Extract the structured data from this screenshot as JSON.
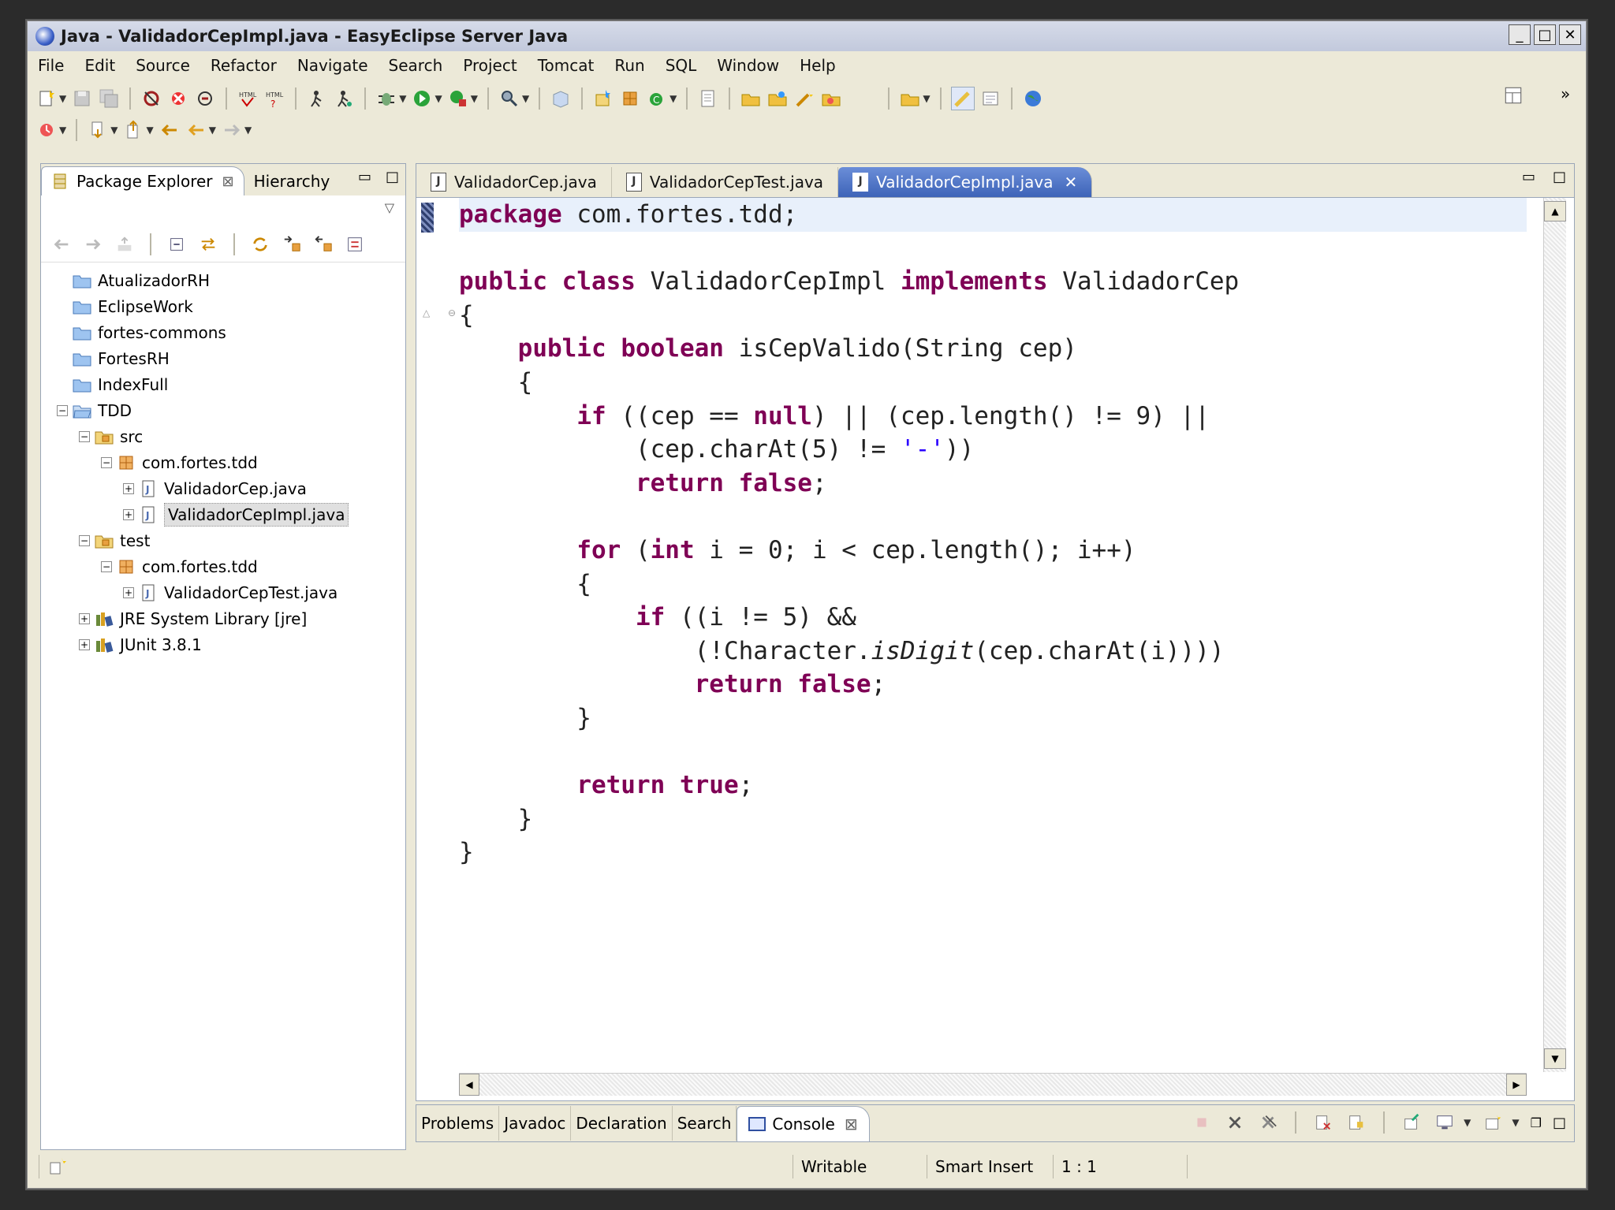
{
  "window": {
    "title": "Java - ValidadorCepImpl.java - EasyEclipse Server Java",
    "controls": [
      "_",
      "□",
      "✕"
    ]
  },
  "menubar": [
    "File",
    "Edit",
    "Source",
    "Refactor",
    "Navigate",
    "Search",
    "Project",
    "Tomcat",
    "Run",
    "SQL",
    "Window",
    "Help"
  ],
  "left_panel": {
    "tabs": [
      {
        "label": "Package Explorer",
        "active": true,
        "closable": true
      },
      {
        "label": "Hierarchy",
        "active": false
      }
    ],
    "tree": [
      {
        "label": "AtualizadorRH",
        "depth": 0,
        "icon": "folder-icon",
        "expander": ""
      },
      {
        "label": "EclipseWork",
        "depth": 0,
        "icon": "folder-icon",
        "expander": ""
      },
      {
        "label": "fortes-commons",
        "depth": 0,
        "icon": "folder-icon",
        "expander": ""
      },
      {
        "label": "FortesRH",
        "depth": 0,
        "icon": "folder-icon",
        "expander": ""
      },
      {
        "label": "IndexFull",
        "depth": 0,
        "icon": "folder-icon",
        "expander": ""
      },
      {
        "label": "TDD",
        "depth": 0,
        "icon": "open-project-icon",
        "expander": "−"
      },
      {
        "label": "src",
        "depth": 1,
        "icon": "source-folder-icon",
        "expander": "−"
      },
      {
        "label": "com.fortes.tdd",
        "depth": 2,
        "icon": "package-icon",
        "expander": "−"
      },
      {
        "label": "ValidadorCep.java",
        "depth": 3,
        "icon": "java-file-icon",
        "expander": "+"
      },
      {
        "label": "ValidadorCepImpl.java",
        "depth": 3,
        "icon": "java-file-icon",
        "expander": "+",
        "selected": true
      },
      {
        "label": "test",
        "depth": 1,
        "icon": "source-folder-icon",
        "expander": "−"
      },
      {
        "label": "com.fortes.tdd",
        "depth": 2,
        "icon": "package-icon",
        "expander": "−"
      },
      {
        "label": "ValidadorCepTest.java",
        "depth": 3,
        "icon": "java-file-icon",
        "expander": "+"
      },
      {
        "label": "JRE System Library [jre]",
        "depth": 1,
        "icon": "library-icon",
        "expander": "+"
      },
      {
        "label": "JUnit 3.8.1",
        "depth": 1,
        "icon": "library-icon",
        "expander": "+"
      }
    ]
  },
  "editor": {
    "tabs": [
      {
        "label": "ValidadorCep.java",
        "active": false
      },
      {
        "label": "ValidadorCepTest.java",
        "active": false
      },
      {
        "label": "ValidadorCepImpl.java",
        "active": true
      }
    ],
    "code": [
      [
        [
          "kw",
          "package"
        ],
        [
          "t",
          " com.fortes.tdd;"
        ]
      ],
      [],
      [
        [
          "kw",
          "public"
        ],
        [
          "t",
          " "
        ],
        [
          "kw",
          "class"
        ],
        [
          "t",
          " ValidadorCepImpl "
        ],
        [
          "kw",
          "implements"
        ],
        [
          "t",
          " ValidadorCep"
        ]
      ],
      [
        [
          "t",
          "{"
        ]
      ],
      [
        [
          "t",
          "    "
        ],
        [
          "kw",
          "public"
        ],
        [
          "t",
          " "
        ],
        [
          "kw",
          "boolean"
        ],
        [
          "t",
          " isCepValido(String cep)"
        ]
      ],
      [
        [
          "t",
          "    {"
        ]
      ],
      [
        [
          "t",
          "        "
        ],
        [
          "kw",
          "if"
        ],
        [
          "t",
          " ((cep == "
        ],
        [
          "kw",
          "null"
        ],
        [
          "t",
          ") || (cep.length() != 9) ||"
        ]
      ],
      [
        [
          "t",
          "            (cep.charAt(5) != "
        ],
        [
          "str",
          "'-'"
        ],
        [
          "t",
          "))"
        ]
      ],
      [
        [
          "t",
          "            "
        ],
        [
          "kw",
          "return"
        ],
        [
          "t",
          " "
        ],
        [
          "kw",
          "false"
        ],
        [
          "t",
          ";"
        ]
      ],
      [],
      [
        [
          "t",
          "        "
        ],
        [
          "kw",
          "for"
        ],
        [
          "t",
          " ("
        ],
        [
          "kw",
          "int"
        ],
        [
          "t",
          " i = 0; i < cep.length(); i++)"
        ]
      ],
      [
        [
          "t",
          "        {"
        ]
      ],
      [
        [
          "t",
          "            "
        ],
        [
          "kw",
          "if"
        ],
        [
          "t",
          " ((i != 5) &&"
        ]
      ],
      [
        [
          "t",
          "                (!Character."
        ],
        [
          "it",
          "isDigit"
        ],
        [
          "t",
          "(cep.charAt(i))))"
        ]
      ],
      [
        [
          "t",
          "                "
        ],
        [
          "kw",
          "return"
        ],
        [
          "t",
          " "
        ],
        [
          "kw",
          "false"
        ],
        [
          "t",
          ";"
        ]
      ],
      [
        [
          "t",
          "        }"
        ]
      ],
      [],
      [
        [
          "t",
          "        "
        ],
        [
          "kw",
          "return"
        ],
        [
          "t",
          " "
        ],
        [
          "kw",
          "true"
        ],
        [
          "t",
          ";"
        ]
      ],
      [
        [
          "t",
          "    }"
        ]
      ],
      [
        [
          "t",
          "}"
        ]
      ]
    ]
  },
  "bottom_panel": {
    "tabs": [
      {
        "label": "Problems",
        "active": false
      },
      {
        "label": "Javadoc",
        "active": false
      },
      {
        "label": "Declaration",
        "active": false
      },
      {
        "label": "Search",
        "active": false
      },
      {
        "label": "Console",
        "active": true,
        "closable": true
      }
    ]
  },
  "status": {
    "mode": "Writable",
    "insert": "Smart Insert",
    "position": "1 : 1"
  }
}
